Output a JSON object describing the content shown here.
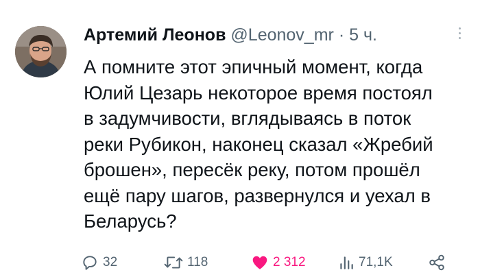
{
  "author": {
    "name": "Артемий Леонов",
    "handle": "@Leonov_mr",
    "separator": "·",
    "time": "5 ч."
  },
  "text_lines": [
    "А помните этот эпичный момент, когда",
    "Юлий Цезарь некоторое время постоял",
    "в задумчивости, вглядываясь в поток",
    "реки Рубикон, наконец сказал «Жребий",
    "брошен», пересёк реку, потом прошёл",
    "ещё пару шагов, развернулся и уехал в",
    "Беларусь?"
  ],
  "actions": {
    "replies": "32",
    "retweets": "118",
    "likes": "2 312",
    "views": "71,1K"
  },
  "colors": {
    "text": "#0f1419",
    "secondary": "#536471",
    "like": "#f91880"
  },
  "icons": {
    "reply": "reply-icon",
    "retweet": "retweet-icon",
    "like": "heart-icon",
    "views": "views-icon",
    "share": "share-icon",
    "more": "more-icon"
  }
}
